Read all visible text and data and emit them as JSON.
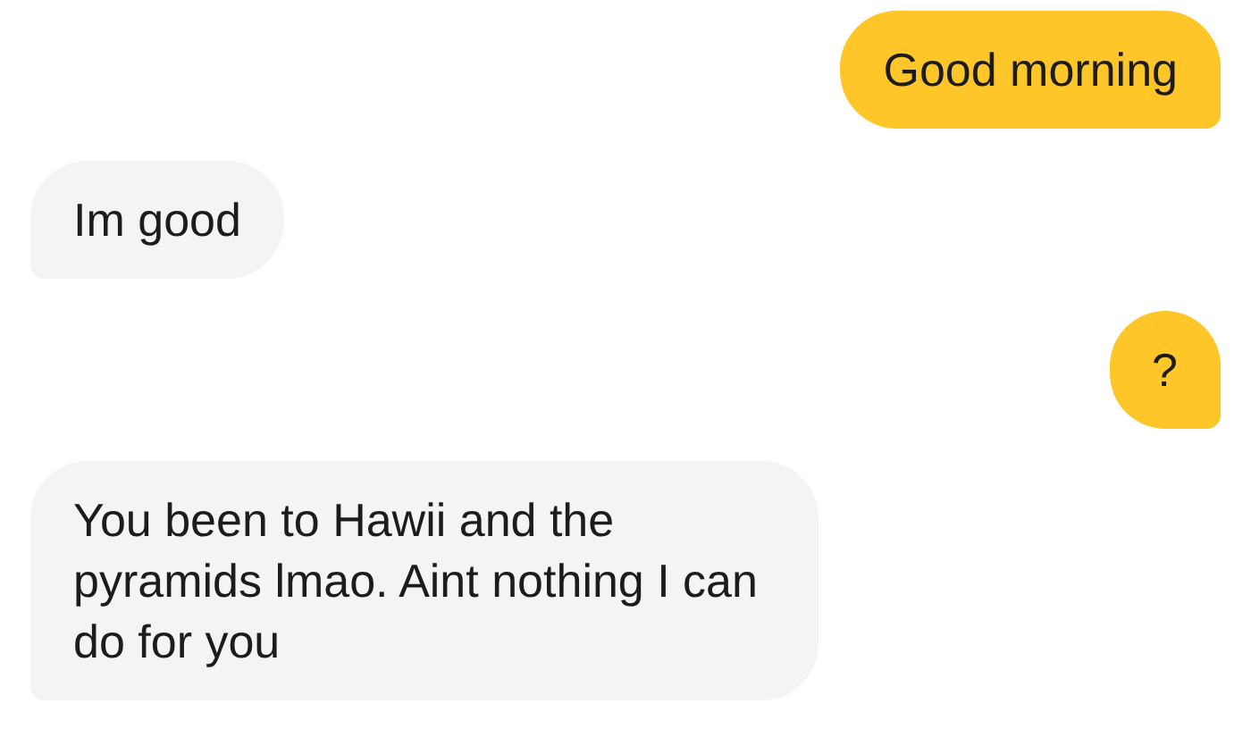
{
  "messages": [
    {
      "kind": "sent",
      "text": "Good morning"
    },
    {
      "kind": "received",
      "text": "Im good"
    },
    {
      "kind": "sent",
      "text": "?"
    },
    {
      "kind": "received",
      "text": "You been to Hawii and the pyramids lmao. Aint nothing I can do for you"
    }
  ]
}
